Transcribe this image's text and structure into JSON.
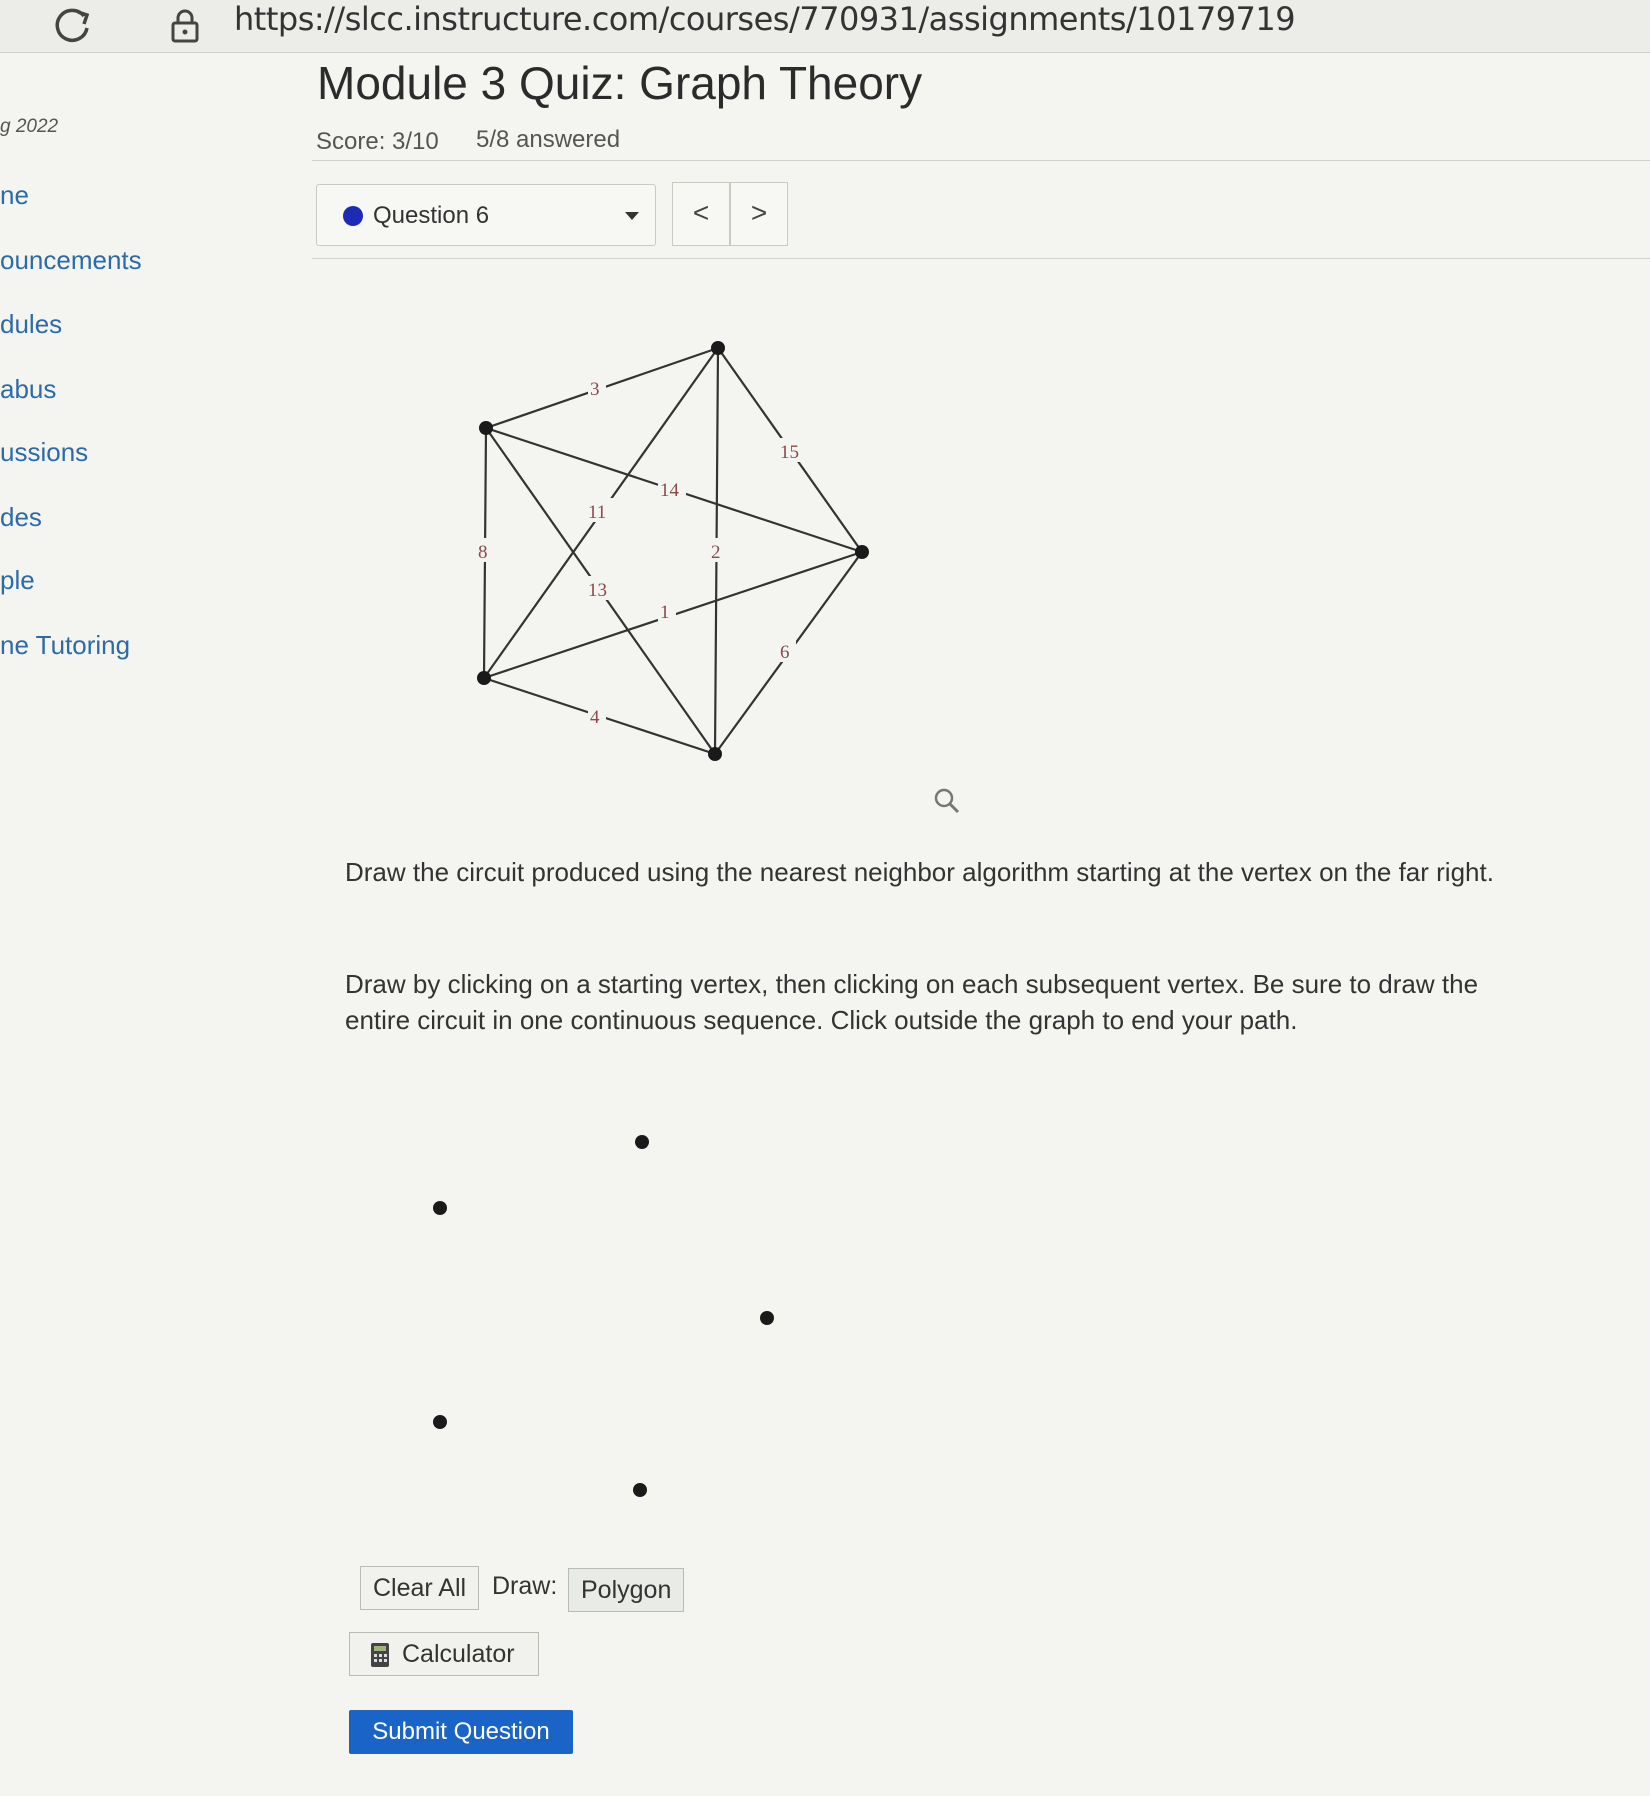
{
  "browser": {
    "url": "https://slcc.instructure.com/courses/770931/assignments/10179719"
  },
  "sidebar": {
    "term": "g 2022",
    "items": [
      "ne",
      "ouncements",
      "dules",
      "abus",
      "ussions",
      "des",
      "ple",
      "ne Tutoring"
    ]
  },
  "quiz": {
    "title": "Module 3 Quiz: Graph Theory",
    "score": "Score: 3/10",
    "answered": "5/8 answered",
    "question_select": "Question 6",
    "prev": "<",
    "next": ">"
  },
  "graph": {
    "edge_labels": {
      "a": "3",
      "b": "15",
      "c": "14",
      "d": "11",
      "e": "8",
      "f": "2",
      "g": "13",
      "h": "1",
      "i": "6",
      "j": "4"
    }
  },
  "instructions": {
    "p1": "Draw the circuit produced using the nearest neighbor algorithm starting at the vertex on the far right.",
    "p2": "Draw by clicking on a starting vertex, then clicking on each subsequent vertex. Be sure to draw the entire circuit in one continuous sequence. Click outside the graph to end your path."
  },
  "controls": {
    "clear_all": "Clear All",
    "draw_label": "Draw:",
    "polygon": "Polygon",
    "calculator": "Calculator",
    "submit": "Submit Question"
  },
  "colors": {
    "accent": "#1a64c8",
    "link": "#2d6ba8",
    "question_dot": "#1b2bb8"
  },
  "icons": [
    "reload-icon",
    "lock-icon",
    "chevron-down-icon",
    "magnifier-icon",
    "calculator-icon"
  ]
}
